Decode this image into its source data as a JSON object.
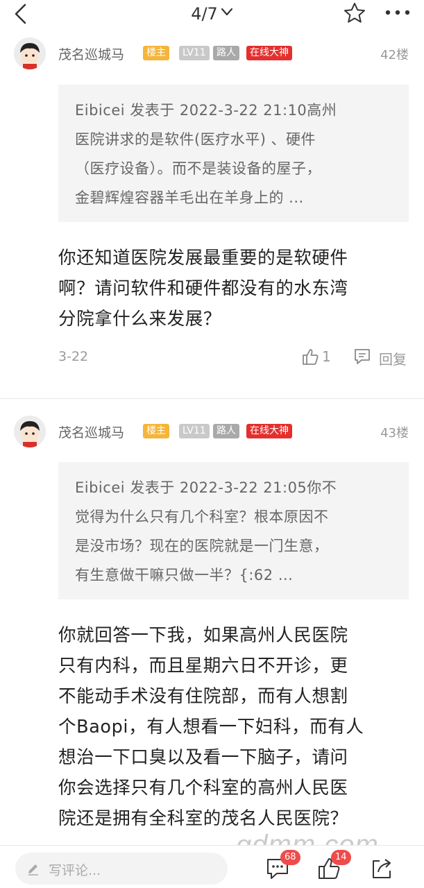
{
  "nav": {
    "page_indicator": "4/7"
  },
  "posts": [
    {
      "username": "茂名巡城马",
      "badges": [
        "楼主",
        "LV11",
        "路人",
        "在线大神"
      ],
      "floor": "42楼",
      "quote_lines": [
        "Eibicei 发表于 2022-3-22 21:10高州",
        "医院讲求的是软件(医疗水平) 、硬件",
        "（医疗设备）。而不是装设备的屋子，",
        "金碧辉煌容器羊毛出在羊身上的 ..."
      ],
      "content_lines": [
        "你还知道医院发展最重要的是软硬件",
        "啊？请问软件和硬件都没有的水东湾",
        "分院拿什么来发展？"
      ],
      "date": "3-22",
      "likes": "1",
      "reply_label": "回复"
    },
    {
      "username": "茂名巡城马",
      "badges": [
        "楼主",
        "LV11",
        "路人",
        "在线大神"
      ],
      "floor": "43楼",
      "quote_lines": [
        "Eibicei 发表于 2022-3-22 21:05你不",
        "觉得为什么只有几个科室？根本原因不",
        "是没市场？现在的医院就是一门生意，",
        "有生意做干嘛只做一半？{:62 ..."
      ],
      "content_lines": [
        "你就回答一下我，如果高州人民医院",
        "只有内科，而且星期六日不开诊，更",
        "不能动手术没有住院部，而有人想割",
        "个Baopi，有人想看一下妇科，而有人",
        "想治一下口臭以及看一下脑子，请问",
        "你会选择只有几个科室的高州人民医",
        "院还是拥有全科室的茂名人民医院？"
      ]
    }
  ],
  "bottom": {
    "comment_placeholder": "写评论...",
    "comment_count": "68",
    "like_count": "14"
  },
  "watermark": "gdmm.com",
  "colors": {
    "host_badge": "#f5b53b",
    "level_badge": "#c9c9c9",
    "role_badge": "#a9a9a9",
    "god_badge": "#e3302e",
    "notify_badge": "#ef4b4b"
  }
}
